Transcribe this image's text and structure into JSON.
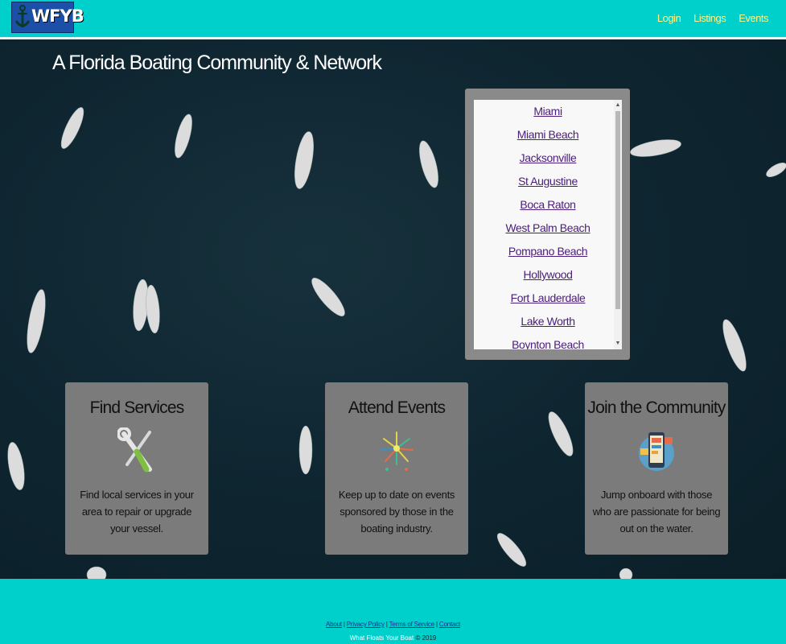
{
  "header": {
    "logo_text": "WFYB",
    "nav": [
      "Login",
      "Listings",
      "Events"
    ]
  },
  "hero": {
    "headline": "A Florida Boating Community & Network"
  },
  "cities": [
    "Miami",
    "Miami Beach",
    "Jacksonville",
    "St Augustine",
    "Boca Raton",
    "West Palm Beach",
    "Pompano Beach",
    "Hollywood",
    "Fort Lauderdale",
    "Lake Worth",
    "Boynton Beach"
  ],
  "cards": [
    {
      "title": "Find Services",
      "icon": "wrench-screwdriver-icon",
      "text": "Find local services in your area to repair or upgrade your vessel."
    },
    {
      "title": "Attend Events",
      "icon": "fireworks-icon",
      "text": "Keep up to date on events sponsored by those in the boating industry."
    },
    {
      "title": "Join the Community",
      "icon": "phone-community-icon",
      "text": "Jump onboard with those who are passionate for being out on the water."
    }
  ],
  "footer": {
    "links": [
      "About",
      "Privacy Policy",
      "Terms of Service",
      "Contact"
    ],
    "brand": "What Floats Your Boat",
    "copyright": "© 2019"
  },
  "colors": {
    "accent": "#00d0cc",
    "nav_text": "#f4f78a",
    "card_bg": "#7b7b7b"
  }
}
